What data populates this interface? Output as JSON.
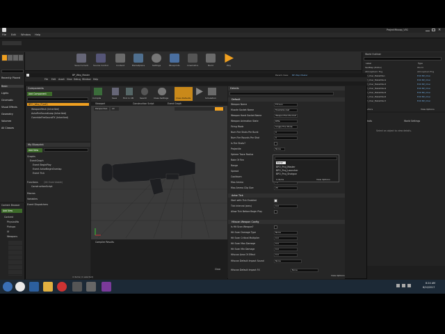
{
  "main_window": {
    "title": "ProjectMcoop_V01",
    "menu": [
      "File",
      "Edit",
      "Window",
      "Help"
    ]
  },
  "modes_panel": {
    "search_placeholder": "Search Classes",
    "categories": [
      "Recently Placed",
      "Basic",
      "Lights",
      "Cinematic",
      "Visual Effects",
      "Geometry",
      "Volumes",
      "All Classes"
    ]
  },
  "main_toolbar": {
    "buttons": [
      "Save Current",
      "Source Control",
      "Content",
      "Marketplace",
      "Settings",
      "Blueprints",
      "Cinematics",
      "Build",
      "Play"
    ]
  },
  "outliner": {
    "title": "World Outliner",
    "header_label": "Label",
    "header_type": "Type",
    "items": [
      {
        "label": "TestMap (Editor)",
        "type": "World"
      },
      {
        "label": "Atmospheric Fog",
        "type": "AtmosphericFog"
      },
      {
        "label": "BP_Char_MetalMan",
        "type": "Edit BP_Char"
      },
      {
        "label": "BP_Char_MetalMan2",
        "type": "Edit BP_Char"
      },
      {
        "label": "BP_Char_MetalMan3",
        "type": "Edit BP_Char"
      },
      {
        "label": "BP_Char_MetalMan4",
        "type": "Edit BP_Char"
      },
      {
        "label": "BP_Char_MetalMan5",
        "type": "Edit BP_Char"
      },
      {
        "label": "BP_Char_MetalMan6",
        "type": "Edit BP_Char"
      },
      {
        "label": "BP_Char_MetalMan7",
        "type": "Edit BP_Char"
      }
    ],
    "actors_count": "37 actors",
    "view_options": "View Options"
  },
  "right_details": {
    "tabs": [
      "Details",
      "World Settings"
    ],
    "empty_text": "Select an object to view details."
  },
  "content_browser": {
    "title": "Content Browser",
    "add_new": "Add New",
    "tree": [
      "Content",
      "PhysicsMa",
      "Pickups",
      "UI",
      "Weapons"
    ]
  },
  "bp_editor": {
    "title": "BP_Wep_Master",
    "parent_class_label": "Parent class:",
    "parent_class": "BP Wep Master",
    "menu": [
      "File",
      "Edit",
      "Asset",
      "View",
      "Debug",
      "Window",
      "Help"
    ],
    "components_title": "Components",
    "add_component": "Add Component",
    "search_placeholder": "Search",
    "components": [
      "BPO_Wep_P(self)",
      "WeaponMesh (Inherited)",
      "AutoFireSoundLoop (Inherited)",
      "OverrideFireSoundFX (Inherited)"
    ],
    "my_blueprint_title": "My Blueprint",
    "add_new": "Add New",
    "graphs_header": "Graphs",
    "event_graph": "EventGraph",
    "events": [
      "Event BeginPlay",
      "Event ActorBeginOverlap",
      "Event Tick"
    ],
    "functions_header": "Functions",
    "functions_count": "(26 Overridable)",
    "construction_script": "ConstructionScript",
    "macros": "Macros",
    "variables": "Variables",
    "event_dispatchers": "Event Dispatchers",
    "toolbar_buttons": [
      "Compile",
      "Save",
      "Find in CB",
      "Search",
      "Class Settings",
      "Class Defaults",
      "Play",
      "Simulation"
    ],
    "viewport_tabs": [
      "Viewport",
      "Construction Script",
      "Event Graph"
    ],
    "viewport_mode": "Perspective",
    "viewport_mode2": "Lit",
    "compiler_title": "Compiler Results",
    "clear": "Clear",
    "status": "4 items (1 selected)"
  },
  "details_panel": {
    "title": "Details",
    "search_placeholder": "Search Details",
    "default_header": "Default",
    "rows": [
      {
        "label": "Weapon Name",
        "value": "FP Gun"
      },
      {
        "label": "Muzzle Socket Name",
        "value": "MuzzleSocket"
      },
      {
        "label": "Weapon Hand Socket Name",
        "value": "WeaponHandSocket"
      },
      {
        "label": "Weapon Animation State",
        "value": "Rifle"
      },
      {
        "label": "Firing Mode",
        "value": "Single Fire Mode"
      },
      {
        "label": "Num Fire Shots Per Burst",
        "value": "0"
      },
      {
        "label": "Num Fire Rounds Per Shot",
        "value": "0"
      },
      {
        "label": "Is Fire Shots?",
        "value": ""
      },
      {
        "label": "Projectile",
        "value": "None"
      },
      {
        "label": "Sphere Trace Radius",
        "value": ""
      },
      {
        "label": "Rate Of Fire",
        "value": ""
      },
      {
        "label": "Range",
        "value": ""
      },
      {
        "label": "Spread",
        "value": ""
      },
      {
        "label": "Cooldown",
        "value": ""
      },
      {
        "label": "Max Ammo",
        "value": "75"
      },
      {
        "label": "Max Ammo Clip Size",
        "value": "25"
      }
    ],
    "actor_tick_header": "Actor Tick",
    "tick_rows": [
      {
        "label": "Start with Tick Enabled",
        "value": ""
      },
      {
        "label": "Tick Interval (secs)",
        "value": "0.0"
      },
      {
        "label": "Allow Tick Before Begin Play",
        "value": ""
      }
    ],
    "hitscan_header": "Hitscan Weapon Config",
    "hitscan_rows": [
      {
        "label": "Is Hit Scan Weapon?",
        "value": ""
      },
      {
        "label": "Hit Scan Damage Type",
        "value": "None"
      },
      {
        "label": "Hit Scan Critical Multiplier",
        "value": "0.0"
      },
      {
        "label": "Hit Scan Max Damage",
        "value": "0.0"
      },
      {
        "label": "Hit Scan Min Damage",
        "value": "0.0"
      },
      {
        "label": "Hitscan Area Of Effect",
        "value": "0.0"
      },
      {
        "label": "Hitscan Default Impact Sound",
        "value": "None"
      },
      {
        "label": "Hitscan Default Impact FX",
        "value": "None"
      }
    ],
    "view_options": "View Options"
  },
  "popup": {
    "search_placeholder": "Search",
    "items": [
      "None",
      "BPO_Proj_Master",
      "BPO_Proj_Launcher",
      "BPO_Proj_Shotgun"
    ],
    "count": "4 items",
    "view_options": "View Options"
  },
  "taskbar": {
    "time": "8:24 AM",
    "date": "8/10/2017"
  },
  "colors": {
    "accent_orange": "#f0a020",
    "selection_blue": "#6fa8dc",
    "taskbar": "#1c2936"
  }
}
